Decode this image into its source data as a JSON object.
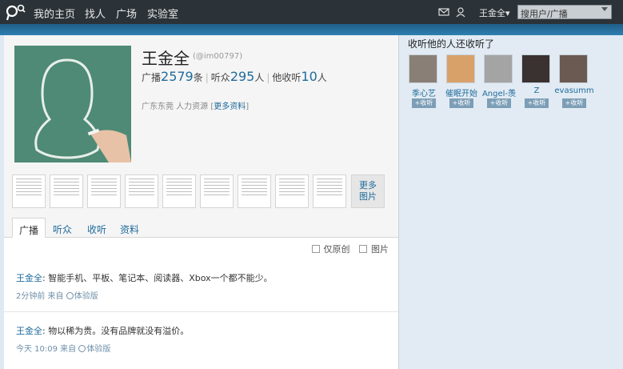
{
  "nav": {
    "links": [
      "我的主页",
      "找人",
      "广场",
      "实验室"
    ],
    "username": "王金全",
    "search_placeholder": "搜用户/广播"
  },
  "profile": {
    "name": "王金全",
    "uid": "(@im00797)",
    "broadcast_label": "广播",
    "broadcast_count": "2579",
    "broadcast_unit": "条",
    "listeners_label": "听众",
    "listeners_count": "295",
    "listeners_unit": "人",
    "following_label": "他收听",
    "following_count": "10",
    "following_unit": "人",
    "location_job": "广东东莞 人力资源",
    "more_info": "更多资料"
  },
  "thumbnails": {
    "more_label_1": "更多",
    "more_label_2": "图片"
  },
  "tabs": [
    "广播",
    "听众",
    "收听",
    "资料"
  ],
  "filters": {
    "original_only": "仅原创",
    "pictures": "图片"
  },
  "posts": [
    {
      "author": "王金全",
      "text": ": 智能手机、平板、笔记本、阅读器、Xbox一个都不能少。",
      "time": "2分钟前 来自",
      "source": "体验版"
    },
    {
      "author": "王金全",
      "text": ": 物以稀为贵。没有品牌就没有溢价。",
      "time": "今天 10:09 来自",
      "source": "体验版"
    }
  ],
  "sidebar": {
    "title": "收听他的人还收听了",
    "follow_label": "+收听",
    "fans": [
      {
        "name": "季心艺",
        "color": "#8a7f76"
      },
      {
        "name": "催眠开始",
        "color": "#d9a16a"
      },
      {
        "name": "Angel-羡",
        "color": "#a4a4a4"
      },
      {
        "name": "Z",
        "color": "#3a3230"
      },
      {
        "name": "evasumm",
        "color": "#6b5a52"
      }
    ]
  }
}
